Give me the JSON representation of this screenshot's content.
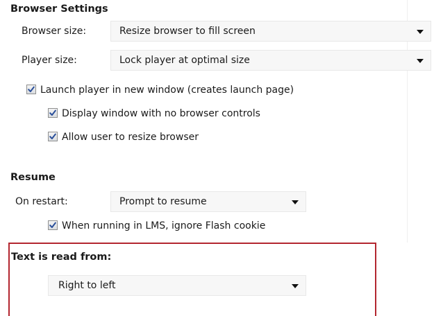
{
  "browser_settings": {
    "heading": "Browser Settings",
    "browser_size": {
      "label": "Browser size:",
      "value": "Resize browser to fill screen"
    },
    "player_size": {
      "label": "Player size:",
      "value": "Lock player at optimal size"
    },
    "launch_new_window": {
      "label": "Launch player in new window (creates launch page)",
      "checked": true
    },
    "no_browser_controls": {
      "label": "Display window with no browser controls",
      "checked": true
    },
    "allow_resize": {
      "label": "Allow user to resize browser",
      "checked": true
    }
  },
  "resume": {
    "heading": "Resume",
    "on_restart": {
      "label": "On restart:",
      "value": "Prompt to resume"
    },
    "ignore_flash_cookie": {
      "label": "When running in LMS, ignore Flash cookie",
      "checked": true
    }
  },
  "text_direction": {
    "heading": "Text is read from:",
    "value": "Right to left"
  },
  "colors": {
    "highlight_border": "#b3262f",
    "checkmark": "#2a4f9a",
    "select_background": "#f7f7f7"
  }
}
